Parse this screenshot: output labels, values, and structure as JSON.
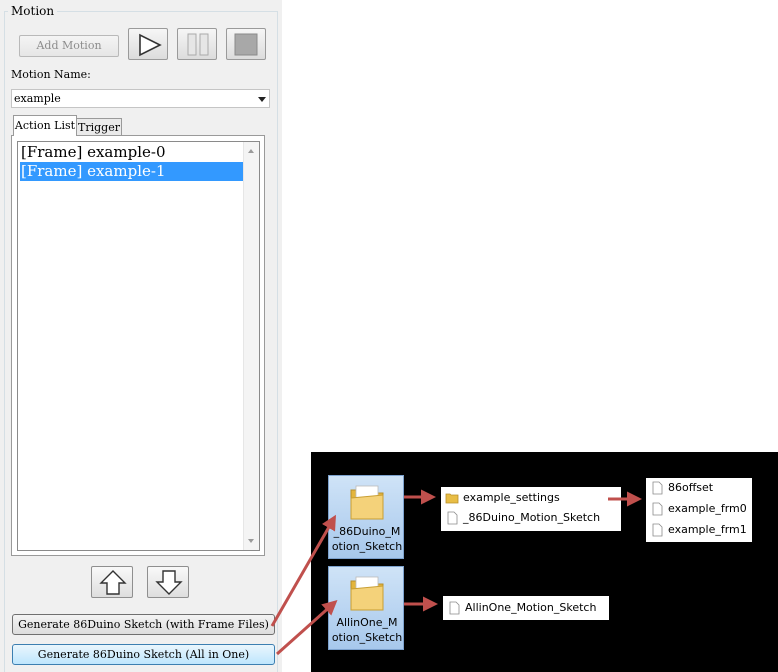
{
  "panel": {
    "group_title": "Motion",
    "add_motion_label": "Add Motion",
    "motion_name_label": "Motion Name:",
    "motion_name_value": "example",
    "tabs": [
      {
        "label": "Action List"
      },
      {
        "label": "Trigger"
      }
    ],
    "action_list": [
      {
        "label": "[Frame] example-0"
      },
      {
        "label": "[Frame] example-1"
      }
    ],
    "generate_with_frames_label": "Generate 86Duino Sketch (with Frame Files)",
    "generate_all_in_one_label": "Generate 86Duino Sketch (All in One)"
  },
  "explorer": {
    "folders": [
      {
        "caption": "_86Duino_M\notion_Sketch"
      },
      {
        "caption": "AllinOne_M\notion_Sketch"
      }
    ],
    "folder1_contents": [
      {
        "label": "example_settings"
      },
      {
        "label": "_86Duino_Motion_Sketch"
      }
    ],
    "settings_contents": [
      {
        "label": "86offset"
      },
      {
        "label": "example_frm0"
      },
      {
        "label": "example_frm1"
      }
    ],
    "folder2_contents": [
      {
        "label": "AllinOne_Motion_Sketch"
      }
    ]
  },
  "colors": {
    "selection": "#3399ff",
    "arrow": "#c0504d",
    "explorer_bg": "#000000"
  }
}
